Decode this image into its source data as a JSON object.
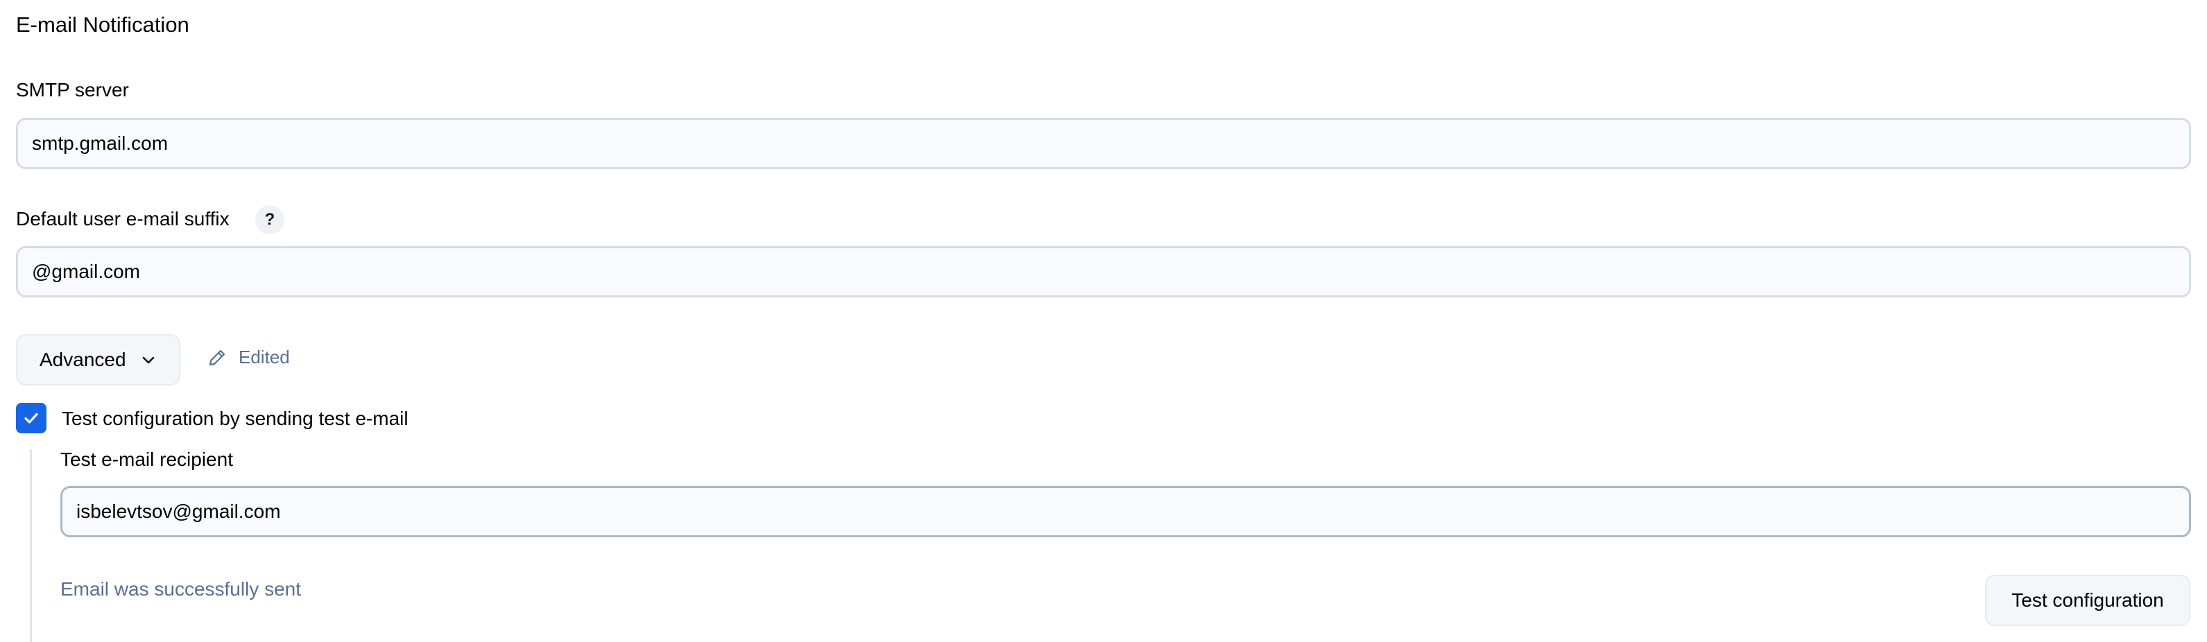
{
  "section": {
    "title": "E-mail Notification"
  },
  "smtp": {
    "label": "SMTP server",
    "value": "smtp.gmail.com"
  },
  "suffix": {
    "label": "Default user e-mail suffix",
    "help": "?",
    "value": "@gmail.com"
  },
  "advanced": {
    "label": "Advanced",
    "edited_label": "Edited"
  },
  "test": {
    "checkbox_label": "Test configuration by sending test e-mail",
    "checked": true,
    "recipient_label": "Test e-mail recipient",
    "recipient_value": "isbelevtsov@gmail.com",
    "status_message": "Email was successfully sent",
    "button_label": "Test configuration"
  },
  "icons": {
    "advanced_chevron": "chevron-down-icon",
    "edited": "pencil-icon",
    "checkbox": "checkmark-icon"
  },
  "colors": {
    "accent": "#1565e6",
    "muted_text": "#5a6f95",
    "input_border": "#d5dce6",
    "input_background": "#f8fafd"
  }
}
